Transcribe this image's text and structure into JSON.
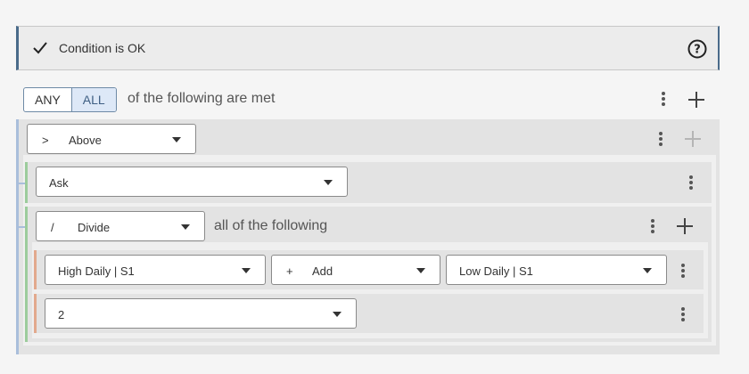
{
  "status": {
    "message": "Condition is OK",
    "icon": "check-icon",
    "help_icon": "help-circle-icon"
  },
  "toggle": {
    "any_label": "ANY",
    "all_label": "ALL",
    "selected": "ALL",
    "suffix_text": "of the following are met"
  },
  "root_operator": {
    "symbol": ">",
    "label": "Above"
  },
  "ask_field": {
    "label": "Ask"
  },
  "divide_operator": {
    "symbol": "/",
    "label": "Divide",
    "suffix_text": "all of the following"
  },
  "high_daily_row": {
    "field1": "High Daily | S1",
    "operator_symbol": "+",
    "operator_label": "Add",
    "field2": "Low Daily | S1"
  },
  "constant_row": {
    "value": "2"
  },
  "colors": {
    "accent_blue": "#4a6b8a",
    "toggle_selected_bg": "#dde8f7",
    "group_line": "#a9bedb",
    "green_line": "#9ccc9c",
    "orange_line": "#e2a98d"
  }
}
